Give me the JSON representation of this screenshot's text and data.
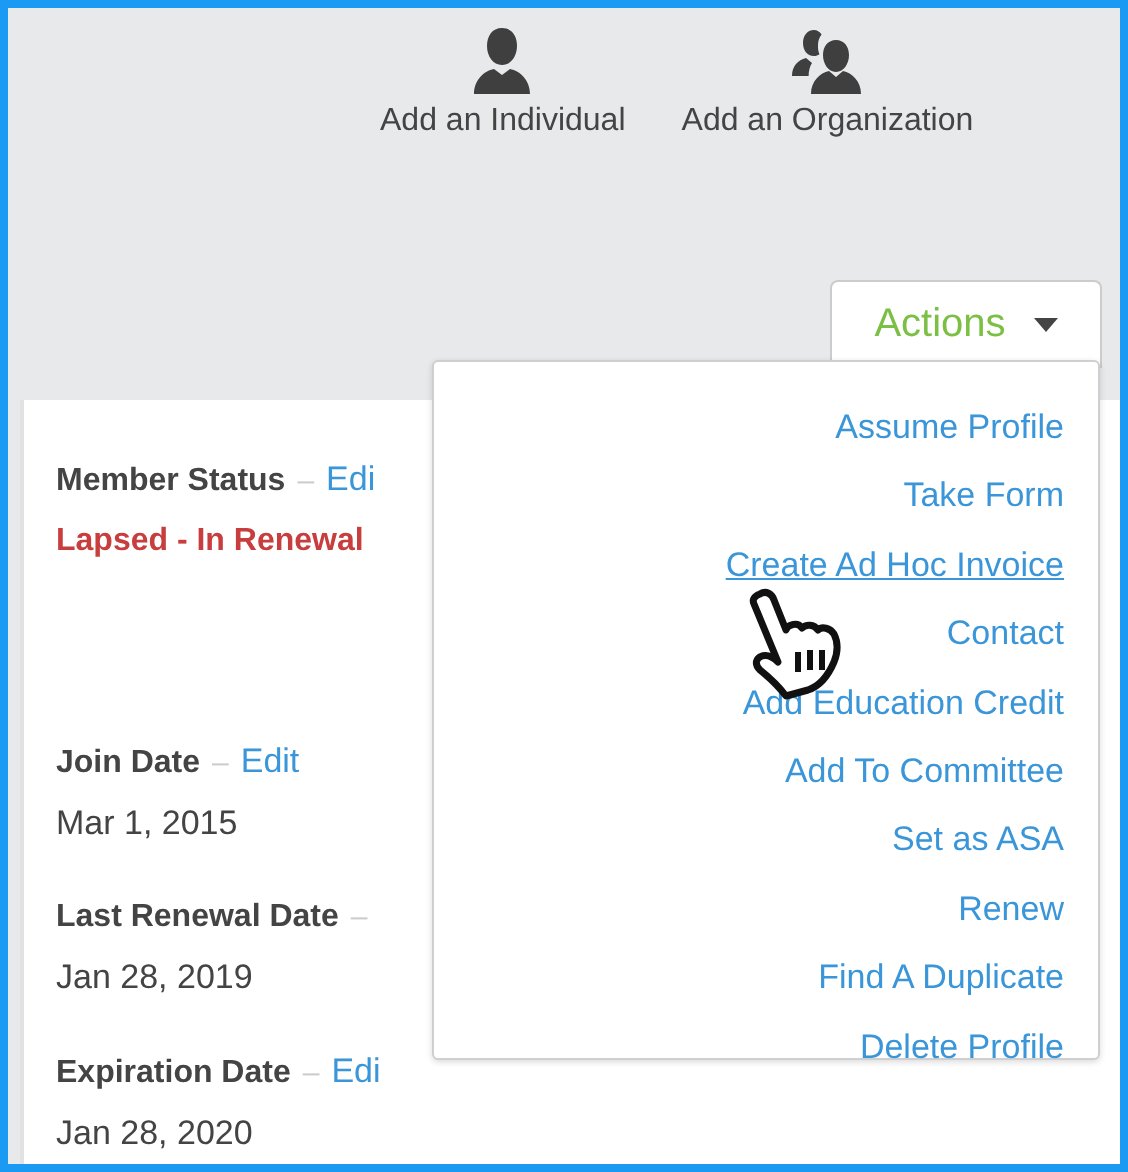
{
  "quick_actions": [
    {
      "kind": "individual",
      "label": "Add an Individual"
    },
    {
      "kind": "organization",
      "label": "Add an Organization"
    }
  ],
  "actions_button": {
    "label": "Actions",
    "expanded": true
  },
  "actions_menu": [
    {
      "label": "Assume Profile",
      "hovered": false
    },
    {
      "label": "Take Form",
      "hovered": false
    },
    {
      "label": "Create Ad Hoc Invoice",
      "hovered": true
    },
    {
      "label": "Contact",
      "hovered": false
    },
    {
      "label": "Add Education Credit",
      "hovered": false
    },
    {
      "label": "Add To Committee",
      "hovered": false
    },
    {
      "label": "Set as ASA",
      "hovered": false
    },
    {
      "label": "Renew",
      "hovered": false
    },
    {
      "label": "Find A Duplicate",
      "hovered": false
    },
    {
      "label": "Delete Profile",
      "hovered": false
    }
  ],
  "fields": [
    {
      "label": "Member Status",
      "separator": "–",
      "edit": "Edi",
      "value": "Lapsed - In Renewal",
      "kind": "status"
    },
    {
      "label": "Join Date",
      "separator": "–",
      "edit": "Edit",
      "value": "Mar 1, 2015",
      "kind": "date"
    },
    {
      "label": "Last Renewal Date",
      "separator": "–",
      "value": "Jan 28, 2019",
      "kind": "date"
    },
    {
      "label": "Expiration Date",
      "separator": "–",
      "edit": "Edi",
      "value": "Jan 28, 2020",
      "kind": "date"
    }
  ]
}
